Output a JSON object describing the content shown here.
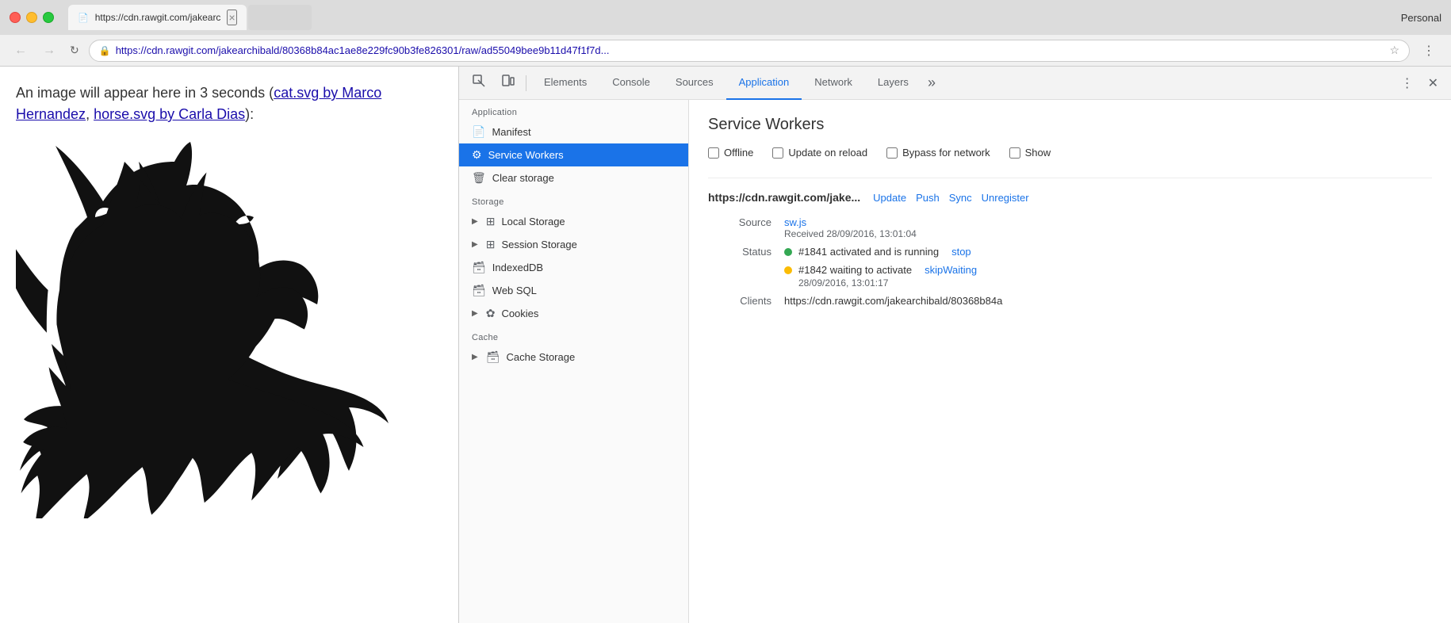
{
  "browser": {
    "profile": "Personal",
    "tab": {
      "icon": "📄",
      "title": "https://cdn.rawgit.com/jakearc",
      "close": "×"
    },
    "address": {
      "url": "https://cdn.rawgit.com/jakearchibald/80368b84ac1ae8e229fc90b3fe826301/raw/ad55049bee9b11d47f1f7d...",
      "url_display": "https://cdn.rawgit.com/jakearchibald/80368b84ac1ae8e229fc90b3fe826301/raw/ad55049bee9b11d47f1f7d..."
    }
  },
  "page": {
    "text_before": "An image will appear here in 3 seconds (",
    "link1_text": "cat.svg by Marco Hernandez",
    "link1_separator": ", ",
    "link2_text": "horse.svg by Carla Dias",
    "text_after": "):"
  },
  "devtools": {
    "tabs": [
      {
        "id": "elements",
        "label": "Elements"
      },
      {
        "id": "console",
        "label": "Console"
      },
      {
        "id": "sources",
        "label": "Sources"
      },
      {
        "id": "application",
        "label": "Application"
      },
      {
        "id": "network",
        "label": "Network"
      },
      {
        "id": "layers",
        "label": "Layers"
      }
    ],
    "more_tabs_label": "»",
    "sidebar": {
      "sections": [
        {
          "id": "application",
          "label": "Application",
          "items": [
            {
              "id": "manifest",
              "label": "Manifest",
              "icon": "📄",
              "active": false
            },
            {
              "id": "service-workers",
              "label": "Service Workers",
              "icon": "⚙",
              "active": true
            },
            {
              "id": "clear-storage",
              "label": "Clear storage",
              "icon": "🗑",
              "active": false
            }
          ]
        },
        {
          "id": "storage",
          "label": "Storage",
          "items": [
            {
              "id": "local-storage",
              "label": "Local Storage",
              "icon": "▶",
              "expandable": true,
              "active": false
            },
            {
              "id": "session-storage",
              "label": "Session Storage",
              "icon": "▶",
              "expandable": true,
              "active": false
            },
            {
              "id": "indexeddb",
              "label": "IndexedDB",
              "icon": "🗃",
              "active": false
            },
            {
              "id": "web-sql",
              "label": "Web SQL",
              "icon": "🗃",
              "active": false
            },
            {
              "id": "cookies",
              "label": "Cookies",
              "icon": "▶",
              "expandable": true,
              "active": false
            }
          ]
        },
        {
          "id": "cache",
          "label": "Cache",
          "items": [
            {
              "id": "cache-storage",
              "label": "Cache Storage",
              "icon": "▶",
              "expandable": true,
              "active": false
            }
          ]
        }
      ]
    },
    "panel": {
      "title": "Service Workers",
      "options": [
        {
          "id": "offline",
          "label": "Offline"
        },
        {
          "id": "update-on-reload",
          "label": "Update on reload"
        },
        {
          "id": "bypass-for-network",
          "label": "Bypass for network"
        },
        {
          "id": "show",
          "label": "Show"
        }
      ],
      "sw_url": "https://cdn.rawgit.com/jake...",
      "sw_actions": [
        "Update",
        "Push",
        "Sync",
        "Unregister"
      ],
      "source_label": "Source",
      "source_file": "sw.js",
      "source_received": "Received 28/09/2016, 13:01:04",
      "status_label": "Status",
      "status1_dot": "green",
      "status1_text": "#1841 activated and is running",
      "status1_action": "stop",
      "status2_dot": "orange",
      "status2_text": "#1842 waiting to activate",
      "status2_action": "skipWaiting",
      "status2_time": "28/09/2016, 13:01:17",
      "clients_label": "Clients",
      "clients_value": "https://cdn.rawgit.com/jakearchibald/80368b84a"
    }
  }
}
